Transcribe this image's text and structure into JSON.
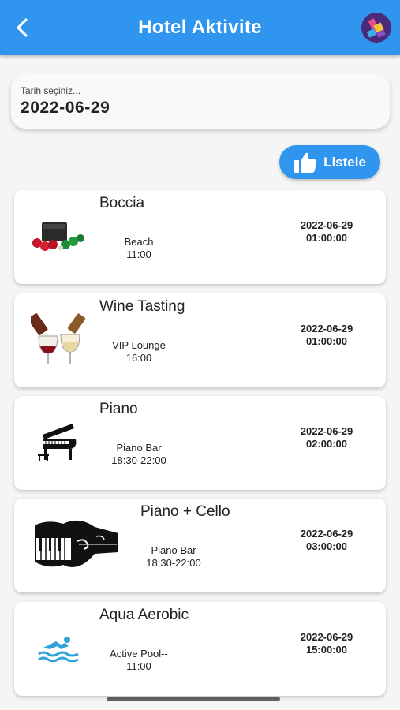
{
  "header": {
    "title": "Hotel Aktivite",
    "back_icon": "chevron-left-icon",
    "avatar_icon": "app-logo-icon",
    "color": "#2f95ef"
  },
  "date_picker": {
    "label": "Tarih seçiniz...",
    "value": "2022-06-29"
  },
  "list_button": {
    "label": "Listele",
    "icon": "thumbs-up-icon"
  },
  "activities": [
    {
      "name": "Boccia",
      "location": "Beach",
      "time": "11:00",
      "date": "2022-06-29",
      "clock": "01:00:00",
      "image": "boccia-balls-image"
    },
    {
      "name": "Wine Tasting",
      "location": "VIP Lounge",
      "time": "16:00",
      "date": "2022-06-29",
      "clock": "01:00:00",
      "image": "wine-glasses-image"
    },
    {
      "name": "Piano",
      "location": "Piano Bar",
      "time": "18:30-22:00",
      "date": "2022-06-29",
      "clock": "02:00:00",
      "image": "grand-piano-image"
    },
    {
      "name": "Piano + Cello",
      "location": "Piano Bar",
      "time": "18:30-22:00",
      "date": "2022-06-29",
      "clock": "03:00:00",
      "image": "piano-cello-image"
    },
    {
      "name": "Aqua Aerobic",
      "location": "Active Pool--",
      "time": "11:00",
      "date": "2022-06-29",
      "clock": "15:00:00",
      "image": "swimmer-icon"
    }
  ]
}
